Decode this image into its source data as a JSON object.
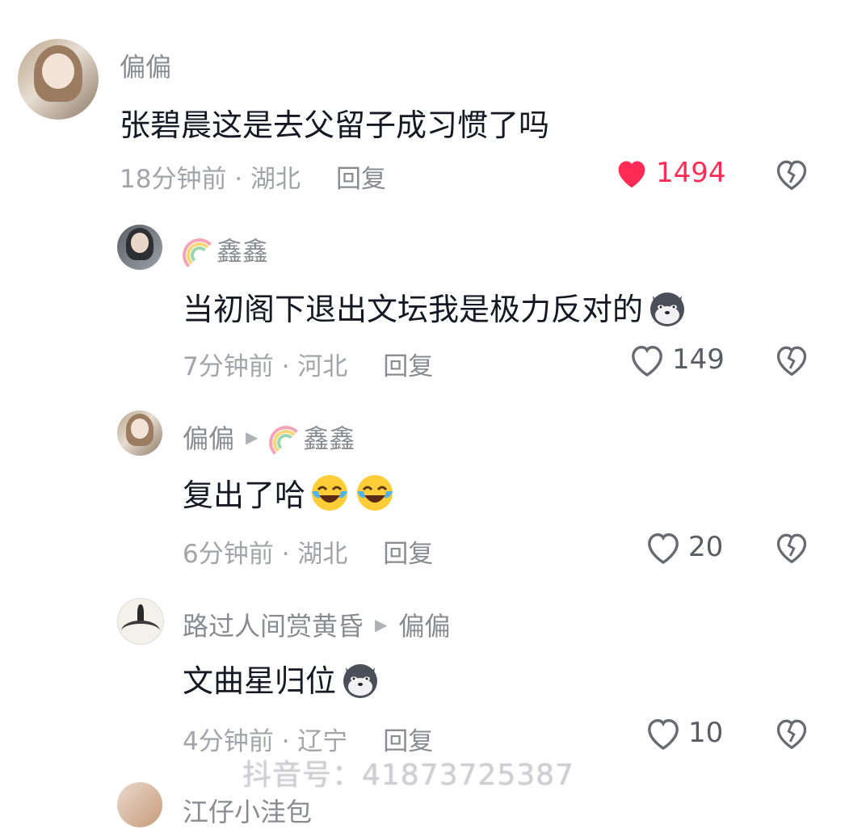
{
  "comments": [
    {
      "name": "偏偏",
      "text": "张碧晨这是去父留子成习惯了吗",
      "time_location": "18分钟前 · 湖北",
      "reply_label": "回复",
      "likes": "1494",
      "liked": true
    },
    {
      "name": "鑫鑫",
      "text": "当初阁下退出文坛我是极力反对的",
      "emoji": "dog-emoji",
      "time_location": "7分钟前 · 河北",
      "reply_label": "回复",
      "likes": "149",
      "liked": false
    },
    {
      "name": "偏偏",
      "reply_to": "鑫鑫",
      "text": "复出了哈",
      "emoji": "laughing-crying-emoji",
      "time_location": "6分钟前 · 湖北",
      "reply_label": "回复",
      "likes": "20",
      "liked": false
    },
    {
      "name": "路过人间赏黄昏",
      "reply_to": "偏偏",
      "text": "文曲星归位",
      "emoji": "dog-emoji",
      "time_location": "4分钟前 · 辽宁",
      "reply_label": "回复",
      "likes": "10",
      "liked": false
    },
    {
      "name": "江仔小洼包"
    }
  ],
  "watermark": "抖音号：41873725387",
  "colors": {
    "like_red": "#fe2c55",
    "meta_gray": "#a3a4a9",
    "name_gray": "#8a8b91",
    "text": "#161823"
  }
}
